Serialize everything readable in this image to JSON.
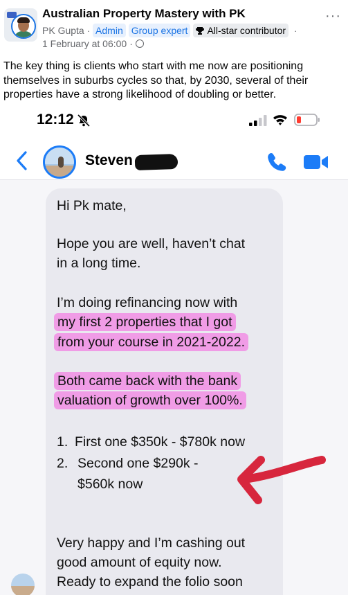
{
  "post": {
    "group_name": "Australian Property Mastery with PK",
    "author": "PK Gupta",
    "separator": "·",
    "badges": [
      "Admin",
      "Group expert",
      "All-star contributor"
    ],
    "badge_trailing_dot": "·",
    "timestamp": "1 February at 06:00",
    "menu_label": "···",
    "text": "The key thing is clients who start with me now are positioning themselves in suburbs cycles so that, by 2030, several of their properties have a strong likelihood of doubling or better."
  },
  "screenshot": {
    "status_time": "12:12",
    "contact_name": "Steven",
    "messages": {
      "greeting": "Hi Pk mate,",
      "line1": "Hope you are well, haven’t chat",
      "line2": "in a long time.",
      "line3": "I’m doing refinancing now with",
      "hl1": "my first 2 properties that I got",
      "hl2": "from your course in 2021-2022.",
      "hl3": "Both came back with the bank",
      "hl4": "valuation of growth over 100%.",
      "list": [
        {
          "num": "1.",
          "text": "First one $350k - $780k now"
        },
        {
          "num": "2.",
          "text": "Second one $290k -"
        },
        {
          "num": "",
          "text": "$560k now"
        }
      ],
      "end1": "Very happy and I’m cashing out",
      "end2": "good amount of equity now.",
      "end3": "Ready to expand the folio soon"
    }
  },
  "colors": {
    "accent": "#1b74e4",
    "highlight": "#f55dde",
    "arrow": "#d7263d",
    "ios_blue": "#1c7cf7"
  }
}
